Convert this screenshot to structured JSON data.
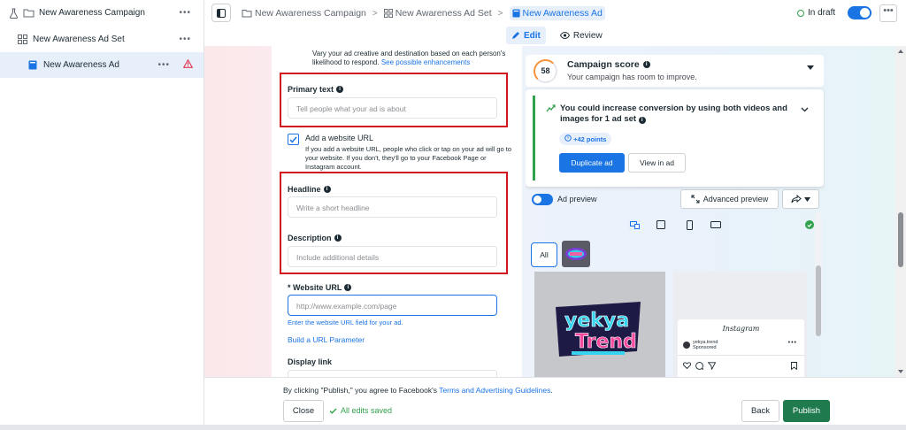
{
  "sidebar": {
    "items": [
      {
        "label": "New Awareness Campaign",
        "icon": "flask-icon"
      },
      {
        "label": "New Awareness Ad Set",
        "icon": "grid-icon"
      },
      {
        "label": "New Awareness Ad",
        "icon": "ad-icon"
      }
    ],
    "more": "•••"
  },
  "breadcrumb": {
    "campaign": "New Awareness Campaign",
    "adset": "New Awareness Ad Set",
    "ad": "New Awareness Ad",
    "separator": ">"
  },
  "header": {
    "status": "In draft",
    "more": "•••"
  },
  "tabs": {
    "edit": "Edit",
    "review": "Review"
  },
  "form": {
    "intro_text": "Vary your ad creative and destination based on each person's likelihood to respond.",
    "intro_link": "See possible enhancements",
    "primary_text": {
      "label": "Primary text",
      "placeholder": "Tell people what your ad is about"
    },
    "website_checkbox": {
      "label": "Add a website URL",
      "description": "If you add a website URL, people who click or tap on your ad will go to your website. If you don't, they'll go to your Facebook Page or Instagram account."
    },
    "headline": {
      "label": "Headline",
      "placeholder": "Write a short headline"
    },
    "description": {
      "label": "Description",
      "placeholder": "Include additional details"
    },
    "website_url": {
      "label": "* Website URL",
      "placeholder": "http://www.example.com/page",
      "helper": "Enter the website URL field for your ad."
    },
    "build_url_link": "Build a URL Parameter",
    "display_link": {
      "label": "Display link"
    }
  },
  "preview": {
    "campaign_score": {
      "value": "58",
      "title": "Campaign score",
      "subtitle": "Your campaign has room to improve."
    },
    "suggestion": {
      "text": "You could increase conversion by using both videos and images for 1 ad set",
      "points": "+42 points",
      "primary_button": "Duplicate ad",
      "secondary_button": "View in ad"
    },
    "ad_preview_label": "Ad preview",
    "advanced_preview": "Advanced preview",
    "all_button": "All",
    "instagram": {
      "title": "Instagram",
      "user": "yekya.trend",
      "sponsored": "Sponsored"
    },
    "brand_text_1": "yekya",
    "brand_text_2": "Trend"
  },
  "footer": {
    "legal_prefix": "By clicking \"Publish,\" you agree to Facebook's",
    "legal_link": "Terms and Advertising Guidelines",
    "legal_suffix": ".",
    "close": "Close",
    "saved": "All edits saved",
    "back": "Back",
    "publish": "Publish"
  },
  "colors": {
    "accent": "#1b74e4",
    "publish": "#1f7a4d",
    "highlight": "#d0161e",
    "success": "#31a24c",
    "score": "#f7923a"
  }
}
